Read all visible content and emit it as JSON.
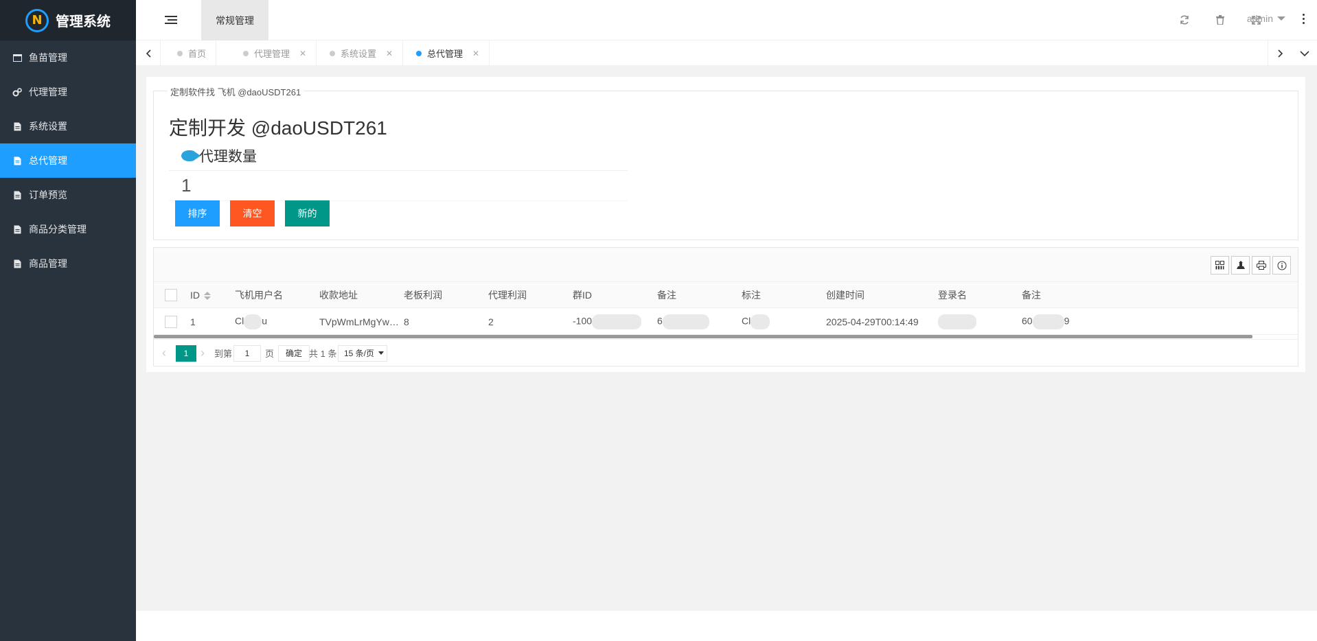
{
  "app": {
    "name": "管理系统",
    "logo_icon": "logo-n-icon"
  },
  "sidebar": {
    "items": [
      {
        "label": "鱼苗管理",
        "icon": "window-icon"
      },
      {
        "label": "代理管理",
        "icon": "gears-icon"
      },
      {
        "label": "系统设置",
        "icon": "document-icon"
      },
      {
        "label": "总代管理",
        "icon": "document-icon",
        "active": true
      },
      {
        "label": "订单预览",
        "icon": "document-icon"
      },
      {
        "label": "商品分类管理",
        "icon": "document-icon"
      },
      {
        "label": "商品管理",
        "icon": "document-icon"
      }
    ]
  },
  "header": {
    "module_tab": "常规管理",
    "user": "admin",
    "icons": [
      "refresh-icon",
      "trash-icon",
      "fullscreen-icon",
      "more-icon"
    ]
  },
  "tabs": [
    {
      "label": "首页",
      "closable": false
    },
    {
      "label": "代理管理",
      "closable": true
    },
    {
      "label": "系统设置",
      "closable": true
    },
    {
      "label": "总代管理",
      "closable": true,
      "active": true
    }
  ],
  "main": {
    "legend": "定制软件找 飞机 @daoUSDT261",
    "title": "定制开发 @daoUSDT261",
    "count_label": "代理数量",
    "count_value": "1",
    "buttons": {
      "sort": "排序",
      "clear": "清空",
      "new": "新的"
    }
  },
  "table": {
    "toolbar_icons": [
      "columns-icon",
      "export-icon",
      "print-icon",
      "info-icon"
    ],
    "columns": [
      "ID",
      "飞机用户名",
      "收款地址",
      "老板利润",
      "代理利润",
      "群ID",
      "备注",
      "标注",
      "创建时间",
      "登录名",
      "备注"
    ],
    "rows": [
      {
        "id": "1",
        "username": "Cl",
        "username_tail": "u",
        "address": "TVpWmLrMgYw…",
        "boss_profit": "8",
        "agent_profit": "2",
        "group_id": "-100",
        "remark": "6",
        "mark": "Cl",
        "created": "2025-04-29T00:14:49",
        "login": "",
        "remark2": "60",
        "remark2_tail": "9"
      }
    ]
  },
  "pagination": {
    "current": "1",
    "goto_label": "到第",
    "goto_value": "1",
    "page_unit": "页",
    "confirm": "确定",
    "total": "共 1 条",
    "page_size": "15 条/页"
  }
}
